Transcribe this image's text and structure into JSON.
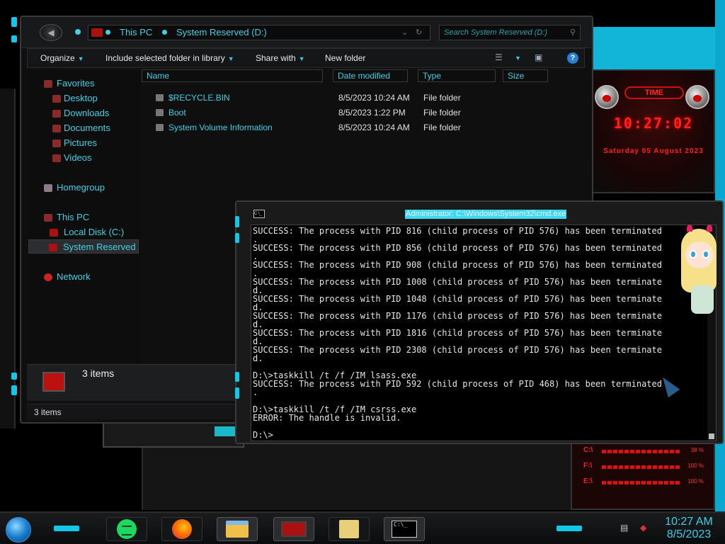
{
  "explorer": {
    "breadcrumb": [
      "This PC",
      "System Reserved (D:)"
    ],
    "search_placeholder": "Search System Reserved (D:)",
    "toolbar": {
      "organize": "Organize",
      "include_library": "Include selected folder in library",
      "share_with": "Share with",
      "new_folder": "New folder"
    },
    "nav": {
      "favorites": "Favorites",
      "desktop": "Desktop",
      "downloads": "Downloads",
      "documents": "Documents",
      "pictures": "Pictures",
      "videos": "Videos",
      "homegroup": "Homegroup",
      "this_pc": "This PC",
      "local_disk": "Local Disk (C:)",
      "system_reserved": "System Reserved",
      "network": "Network"
    },
    "columns": {
      "name": "Name",
      "date": "Date modified",
      "type": "Type",
      "size": "Size"
    },
    "files": [
      {
        "name": "$RECYCLE.BIN",
        "date": "8/5/2023 10:24 AM",
        "type": "File folder"
      },
      {
        "name": "Boot",
        "date": "8/5/2023 1:22 PM",
        "type": "File folder"
      },
      {
        "name": "System Volume Information",
        "date": "8/5/2023 10:24 AM",
        "type": "File folder"
      }
    ],
    "details_count": "3 items",
    "status": "3 items"
  },
  "cmd": {
    "title": "Administrator: C:\\Windows\\System32\\cmd.exe",
    "icon_label": "C:\\_",
    "output": "SUCCESS: The process with PID 816 (child process of PID 576) has been terminated\n.\nSUCCESS: The process with PID 856 (child process of PID 576) has been terminated\n.\nSUCCESS: The process with PID 908 (child process of PID 576) has been terminated\n.\nSUCCESS: The process with PID 1008 (child process of PID 576) has been terminate\nd.\nSUCCESS: The process with PID 1048 (child process of PID 576) has been terminate\nd.\nSUCCESS: The process with PID 1176 (child process of PID 576) has been terminate\nd.\nSUCCESS: The process with PID 1816 (child process of PID 576) has been terminate\nd.\nSUCCESS: The process with PID 2308 (child process of PID 576) has been terminate\nd.\n\nD:\\>taskkill /t /f /IM lsass.exe\nSUCCESS: The process with PID 592 (child process of PID 468) has been terminated\n.\n\nD:\\>taskkill /t /f /IM csrss.exe\nERROR: The handle is invalid.\n\nD:\\>"
  },
  "gadget": {
    "title": "TIME",
    "time": "10:27:02",
    "date": "Saturday 05 August 2023"
  },
  "drives": [
    {
      "label": "C:\\",
      "pct": "38 %"
    },
    {
      "label": "F:\\",
      "pct": "100 %"
    },
    {
      "label": "E:\\",
      "pct": "100 %"
    }
  ],
  "taskbar": {
    "time": "10:27 AM",
    "date": "8/5/2023",
    "cmd_glyph": "C:\\_"
  }
}
